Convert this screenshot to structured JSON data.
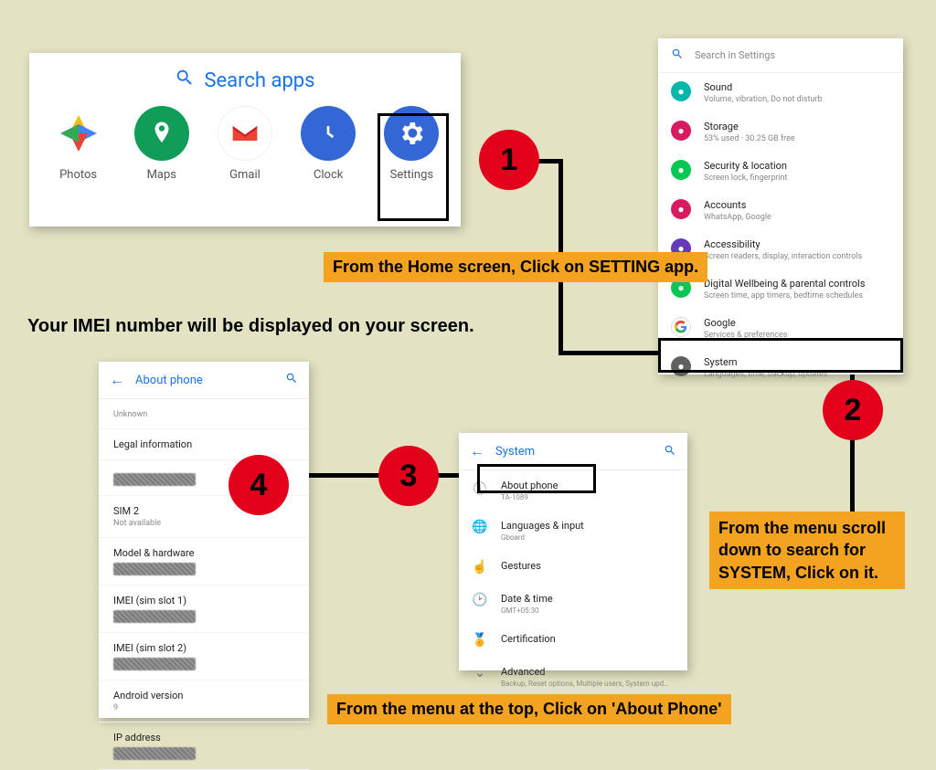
{
  "home": {
    "search_label": "Search apps",
    "apps": [
      {
        "label": "Photos"
      },
      {
        "label": "Maps"
      },
      {
        "label": "Gmail"
      },
      {
        "label": "Clock"
      },
      {
        "label": "Settings"
      }
    ]
  },
  "settings": {
    "search_placeholder": "Search in Settings",
    "items": [
      {
        "title": "Sound",
        "sub": "Volume, vibration, Do not disturb",
        "color": "#00b8a9"
      },
      {
        "title": "Storage",
        "sub": "53% used · 30.25 GB free",
        "color": "#d81b60"
      },
      {
        "title": "Security & location",
        "sub": "Screen lock, fingerprint",
        "color": "#00c853"
      },
      {
        "title": "Accounts",
        "sub": "WhatsApp, Google",
        "color": "#d81b60"
      },
      {
        "title": "Accessibility",
        "sub": "Screen readers, display, interaction controls",
        "color": "#673ab7"
      },
      {
        "title": "Digital Wellbeing & parental controls",
        "sub": "Screen time, app timers, bedtime schedules",
        "color": "#00c853"
      },
      {
        "title": "Google",
        "sub": "Services & preferences",
        "color": "#ffffff"
      },
      {
        "title": "System",
        "sub": "Languages, time, backup, updates",
        "color": "#616161"
      }
    ]
  },
  "system": {
    "title": "System",
    "items": [
      {
        "title": "About phone",
        "sub": "TA-1089",
        "icon": "ⓘ"
      },
      {
        "title": "Languages & input",
        "sub": "Gboard",
        "icon": "🌐"
      },
      {
        "title": "Gestures",
        "sub": "",
        "icon": "☝"
      },
      {
        "title": "Date & time",
        "sub": "GMT+05:30",
        "icon": "🕑"
      },
      {
        "title": "Certification",
        "sub": "",
        "icon": "🏅"
      },
      {
        "title": "Advanced",
        "sub": "Backup, Reset options, Multiple users, System upd…",
        "icon": "⌄"
      }
    ]
  },
  "about": {
    "title": "About phone",
    "rows": [
      {
        "title": "",
        "sub": "Unknown"
      },
      {
        "title": "Legal information",
        "sub": ""
      },
      {
        "title": "",
        "sub": "",
        "blur": true
      },
      {
        "title": "SIM 2",
        "sub": "Not available"
      },
      {
        "title": "Model & hardware",
        "sub": "",
        "blur": true
      },
      {
        "title": "IMEI (sim slot 1)",
        "sub": "",
        "blur": true
      },
      {
        "title": "IMEI (sim slot 2)",
        "sub": "",
        "blur": true
      },
      {
        "title": "Android version",
        "sub": "9"
      },
      {
        "title": "IP address",
        "sub": "",
        "blur": true
      }
    ]
  },
  "steps": {
    "s1": "1",
    "s2": "2",
    "s3": "3",
    "s4": "4",
    "cap1": "From the Home screen, Click on SETTING app.",
    "cap2": "From the menu scroll down to search for SYSTEM, Click on it.",
    "cap3": "From the menu at the top, Click on 'About Phone'",
    "note": "Your IMEI number will be displayed on your screen."
  }
}
